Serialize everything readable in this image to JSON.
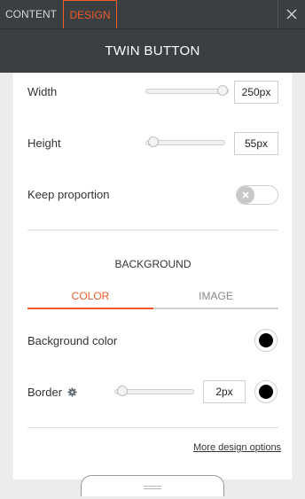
{
  "tabs": {
    "content": "CONTENT",
    "design": "DESIGN"
  },
  "header": {
    "title": "TWIN BUTTON"
  },
  "width": {
    "label": "Width",
    "value": "250px",
    "slider_fraction": 1.0
  },
  "height": {
    "label": "Height",
    "value": "55px",
    "slider_fraction": 0.0
  },
  "keep_proportion": {
    "label": "Keep proportion",
    "enabled": false
  },
  "background": {
    "section_title": "BACKGROUND",
    "tabs": {
      "color": "COLOR",
      "image": "IMAGE"
    },
    "color_label": "Background color",
    "color": "#000000"
  },
  "border": {
    "label": "Border",
    "value": "2px",
    "color": "#000000",
    "slider_fraction": 0.0
  },
  "more_link": "More design options",
  "colors": {
    "accent": "#f25a2a",
    "header_bg": "#3a3f41"
  }
}
